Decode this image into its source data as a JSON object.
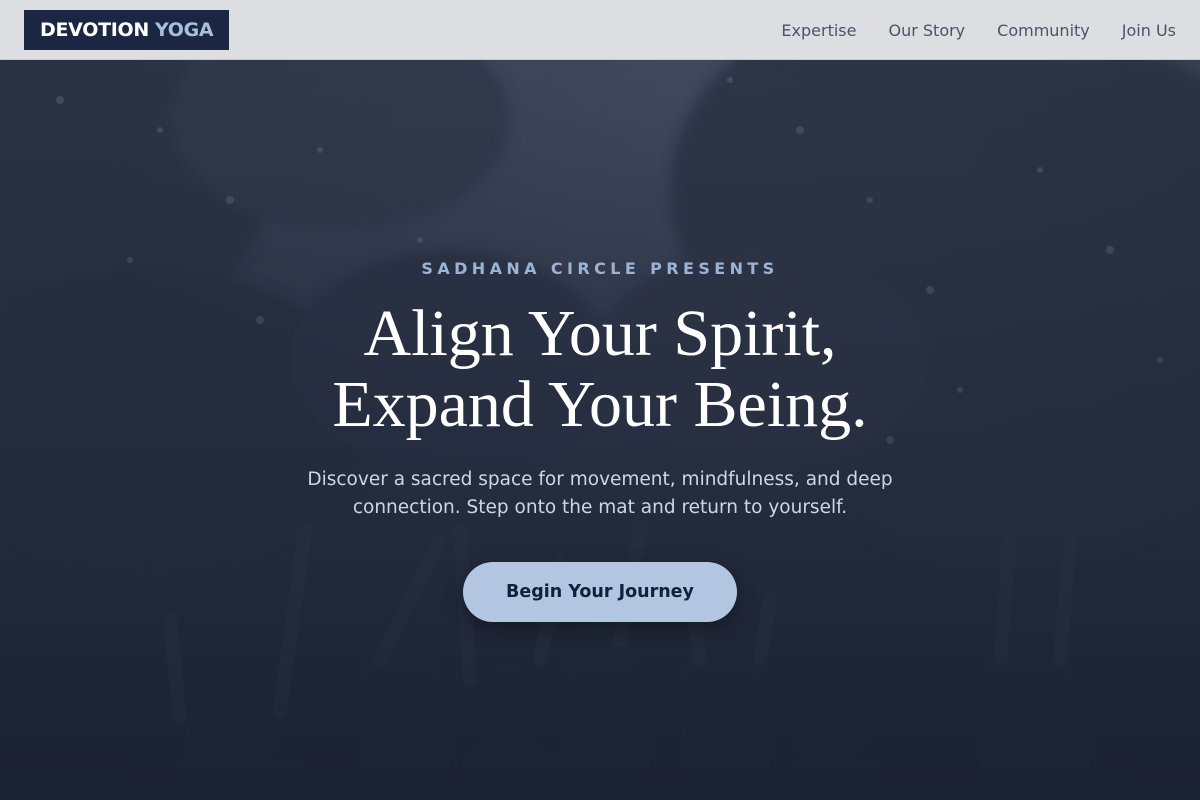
{
  "header": {
    "logo_primary": "DEVOTION",
    "logo_accent": "YOGA",
    "nav": [
      {
        "label": "Expertise"
      },
      {
        "label": "Our Story"
      },
      {
        "label": "Community"
      },
      {
        "label": "Join Us"
      }
    ]
  },
  "hero": {
    "eyebrow": "SADHANA CIRCLE PRESENTS",
    "headline_line1": "Align Your Spirit,",
    "headline_line2": "Expand Your Being.",
    "subtext": "Discover a sacred space for movement, mindfulness, and deep connection. Step onto the mat and return to yourself.",
    "cta_label": "Begin Your Journey",
    "background_image": "forest-yoga-group-raised-arms"
  },
  "colors": {
    "header_bg": "#dcdee2",
    "logo_bg": "#1b2742",
    "logo_accent": "#a9bfdc",
    "nav_text": "#4a5468",
    "eyebrow": "#9db3d3",
    "cta_bg": "#b2c6e1",
    "cta_text": "#13203a",
    "overlay": "#1e2638"
  }
}
